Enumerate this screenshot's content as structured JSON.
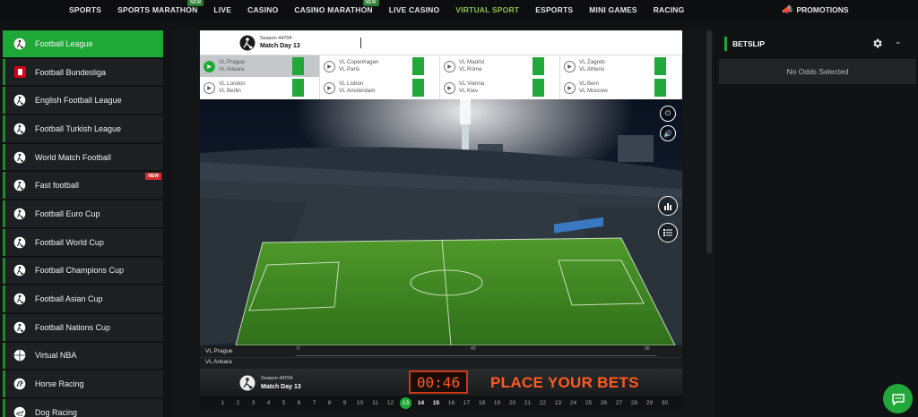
{
  "nav": {
    "items": [
      {
        "label": "SPORTS",
        "new": false,
        "active": false
      },
      {
        "label": "SPORTS MARATHON",
        "new": true,
        "active": false
      },
      {
        "label": "LIVE",
        "new": false,
        "active": false
      },
      {
        "label": "CASINO",
        "new": false,
        "active": false
      },
      {
        "label": "CASINO MARATHON",
        "new": true,
        "active": false
      },
      {
        "label": "LIVE CASINO",
        "new": false,
        "active": false
      },
      {
        "label": "VIRTUAL SPORT",
        "new": false,
        "active": true
      },
      {
        "label": "ESPORTS",
        "new": false,
        "active": false
      },
      {
        "label": "MINI GAMES",
        "new": false,
        "active": false
      },
      {
        "label": "RACING",
        "new": false,
        "active": false
      }
    ],
    "new_tag": "NEW",
    "promotions": "PROMOTIONS"
  },
  "sidebar": {
    "items": [
      {
        "label": "Football League",
        "icon": "soccer-ball-icon",
        "active": true
      },
      {
        "label": "Football Bundesliga",
        "icon": "bundesliga-icon"
      },
      {
        "label": "English Football League",
        "icon": "soccer-ball-icon"
      },
      {
        "label": "Football Turkish League",
        "icon": "soccer-ball-icon"
      },
      {
        "label": "World Match Football",
        "icon": "soccer-ball-icon"
      },
      {
        "label": "Fast football",
        "icon": "soccer-ball-icon",
        "badge": "NEW"
      },
      {
        "label": "Football Euro Cup",
        "icon": "soccer-ball-icon"
      },
      {
        "label": "Football World Cup",
        "icon": "soccer-ball-icon"
      },
      {
        "label": "Football Champions Cup",
        "icon": "soccer-ball-icon"
      },
      {
        "label": "Football Asian Cup",
        "icon": "soccer-ball-icon"
      },
      {
        "label": "Football Nations Cup",
        "icon": "soccer-ball-icon"
      },
      {
        "label": "Virtual NBA",
        "icon": "basketball-icon"
      },
      {
        "label": "Horse Racing",
        "icon": "horse-icon"
      },
      {
        "label": "Dog Racing",
        "icon": "dog-icon"
      }
    ]
  },
  "game": {
    "header": {
      "season": "Season 44704",
      "match_day": "Match Day 13"
    },
    "matches": [
      {
        "home": "VL Prague",
        "away": "VL Ankara",
        "selected": true
      },
      {
        "home": "VL London",
        "away": "VL Berlin"
      },
      {
        "home": "VL Copenhagen",
        "away": "VL Paris"
      },
      {
        "home": "VL Lisbon",
        "away": "VL Amsterdam"
      },
      {
        "home": "VL Madrid",
        "away": "VL Rome"
      },
      {
        "home": "VL Vienna",
        "away": "VL Kiev"
      },
      {
        "home": "VL Zagreb",
        "away": "VL Athens"
      },
      {
        "home": "VL Bern",
        "away": "VL Moscow"
      }
    ],
    "timeline": {
      "home": "VL Prague",
      "away": "VL Ankara",
      "ticks": [
        "0'",
        "45'",
        "90"
      ]
    },
    "bottom": {
      "season": "Season 44704",
      "match_day": "Match Day 13",
      "timer": "00:46",
      "cta": "PLACE YOUR BETS"
    },
    "days": [
      "1",
      "2",
      "3",
      "4",
      "5",
      "6",
      "7",
      "8",
      "9",
      "10",
      "11",
      "12",
      "13",
      "14",
      "15",
      "16",
      "17",
      "18",
      "19",
      "20",
      "21",
      "22",
      "23",
      "24",
      "25",
      "26",
      "27",
      "28",
      "29",
      "30"
    ],
    "current_day": "13"
  },
  "betslip": {
    "title": "BETSLIP",
    "empty": "No Odds Selected"
  },
  "colors": {
    "accent": "#1ea838",
    "timer": "#ff5a1f"
  }
}
